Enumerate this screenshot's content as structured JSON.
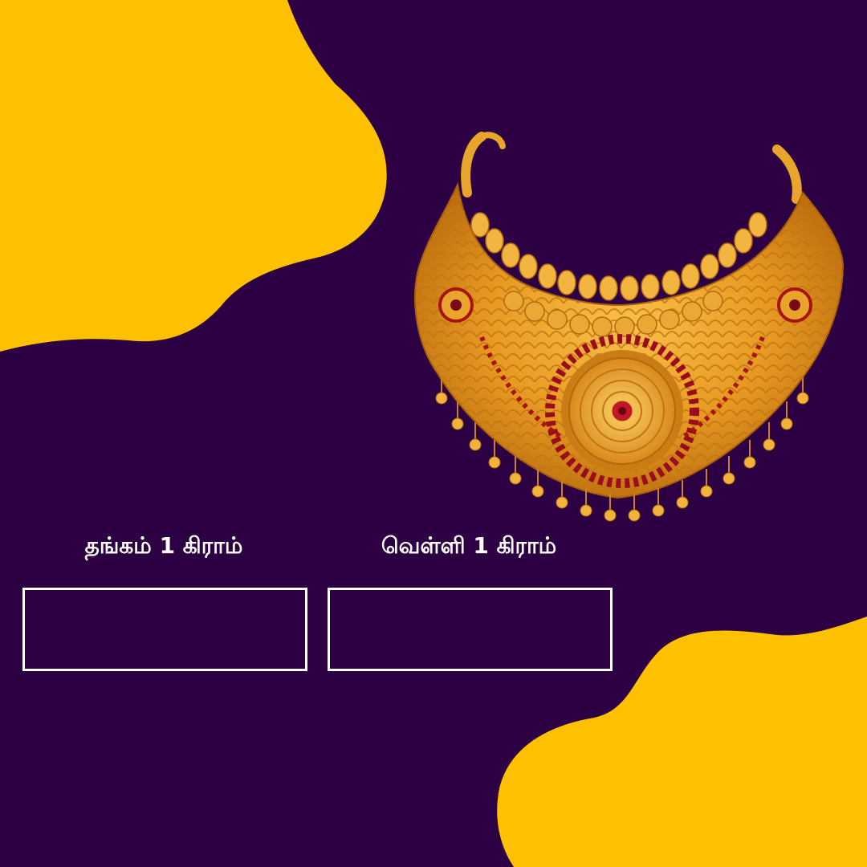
{
  "colors": {
    "background": "#2c0042",
    "accent_yellow": "#fdc102",
    "text": "#ffffff",
    "box_border": "#ffffff"
  },
  "image": {
    "name": "gold-choker-necklace"
  },
  "rates": {
    "gold_label": "தங்கம் 1 கிராம்",
    "silver_label": "வெள்ளி 1 கிராம்",
    "gold_value": "",
    "silver_value": ""
  }
}
